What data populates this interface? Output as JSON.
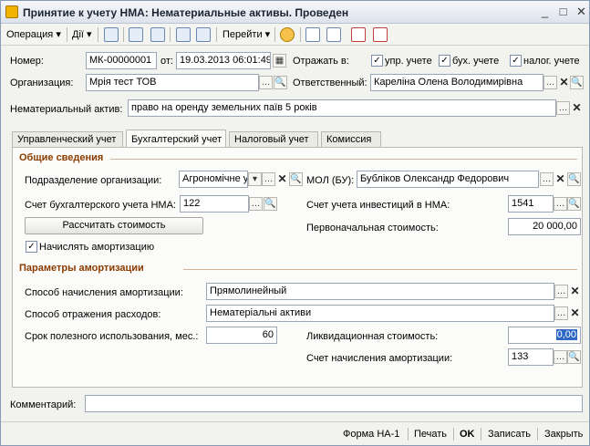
{
  "window": {
    "title": "Принятие к учету НМА: Нематериальные активы. Проведен",
    "controls": [
      "_",
      "□",
      "✕"
    ]
  },
  "toolbar": {
    "operation": "Операция",
    "actions": "Дії",
    "goto": "Перейти"
  },
  "header": {
    "number_label": "Номер:",
    "number_value": "МК-00000001",
    "date_label": "от:",
    "date_value": "19.03.2013 06:01:49",
    "reflect_label": "Отражать в:",
    "reflect_mgmt": "упр. учете",
    "reflect_acc": "бух. учете",
    "reflect_tax": "налог. учете",
    "org_label": "Организация:",
    "org_value": "Мрія тест ТОВ",
    "responsible_label": "Ответственный:",
    "responsible_value": "Кареліна Олена Володимирівна",
    "asset_label": "Нематериальный актив:",
    "asset_value": "право на оренду земельних паїв  5 років"
  },
  "tabs": [
    {
      "label": "Управленческий учет"
    },
    {
      "label": "Бухгалтерский учет"
    },
    {
      "label": "Налоговый учет"
    },
    {
      "label": "Комиссия"
    }
  ],
  "acc": {
    "general_title": "Общие сведения",
    "division_label": "Подразделение организации:",
    "division_value": "Агрономічне у",
    "mol_label": "МОЛ (БУ):",
    "mol_value": "Бубліков Олександр Федорович",
    "account_label": "Счет бухгалтерского учета НМА:",
    "account_value": "122",
    "invest_label": "Счет учета инвестиций в НМА:",
    "invest_value": "1541",
    "calc_button": "Рассчитать стоимость",
    "initial_cost_label": "Первоначальная стоимость:",
    "initial_cost_value": "20 000,00",
    "amortize_label": "Начислять амортизацию",
    "amort_title": "Параметры амортизации",
    "method_label": "Способ начисления амортизации:",
    "method_value": "Прямолинейный",
    "expense_label": "Способ отражения расходов:",
    "expense_value": "Нематеріальні активи",
    "life_label": "Срок полезного использования, мес.:",
    "life_value": "60",
    "liquid_label": "Ликвидационная стоимость:",
    "liquid_value": "0,00",
    "amort_account_label": "Счет начисления амортизации:",
    "amort_account_value": "133"
  },
  "comment_label": "Комментарий:",
  "footer": {
    "form": "Форма НА-1",
    "print": "Печать",
    "ok": "OK",
    "save": "Записать",
    "close": "Закрыть"
  }
}
